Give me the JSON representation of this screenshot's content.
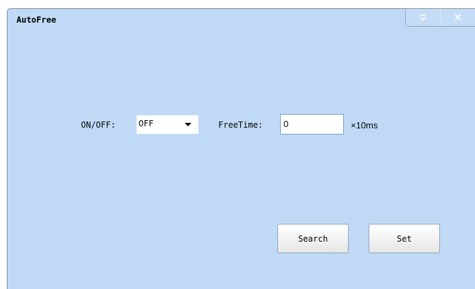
{
  "window": {
    "title": "AutoFree"
  },
  "form": {
    "onoff_label": "ON/OFF:",
    "onoff_value": "OFF",
    "freetime_label": "FreeTime:",
    "freetime_value": "0",
    "unit_label": "×10ms"
  },
  "actions": {
    "search_label": "Search",
    "set_label": "Set"
  },
  "icons": {
    "menu": "menu-icon",
    "close": "close-icon",
    "dropdown": "chevron-down-icon"
  },
  "colors": {
    "background": "#c0daf6",
    "input_background": "#ffffff"
  }
}
